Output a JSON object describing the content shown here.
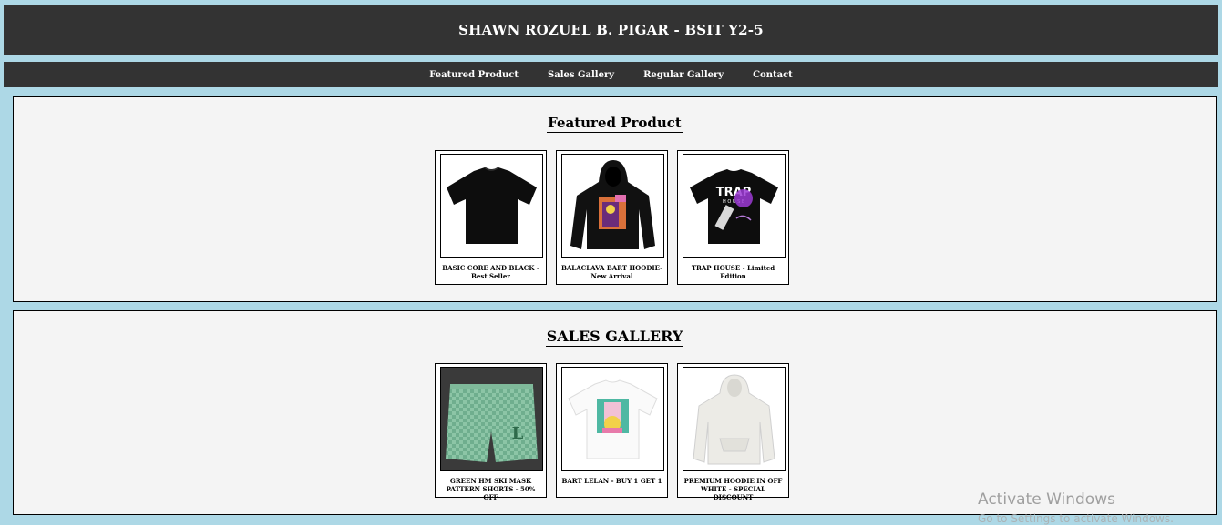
{
  "header": {
    "title": "SHAWN ROZUEL B. PIGAR - BSIT Y2-5"
  },
  "nav": {
    "items": [
      "Featured Product",
      "Sales Gallery",
      "Regular Gallery",
      "Contact"
    ]
  },
  "featured": {
    "title": "Featured Product",
    "products": [
      {
        "caption": "BASIC CORE AND BLACK - Best Seller",
        "image": "black-tshirt"
      },
      {
        "caption": "BALACLAVA BART HOODIE- New Arrival",
        "image": "black-hoodie"
      },
      {
        "caption": "TRAP HOUSE - Limited Edition",
        "image": "trap-house-tshirt"
      }
    ]
  },
  "sales": {
    "title": "SALES GALLERY",
    "products": [
      {
        "caption": "GREEN HM SKI MASK PATTERN SHORTS - 50% OFF",
        "image": "green-shorts"
      },
      {
        "caption": "BART LELAN - BUY 1 GET 1",
        "image": "white-graphic-tshirt"
      },
      {
        "caption": "PREMIUM HOODIE IN OFF WHITE - SPECIAL DISCOUNT",
        "image": "offwhite-hoodie"
      }
    ]
  },
  "watermark": {
    "line1": "Activate Windows",
    "line2": "Go to Settings to activate Windows."
  },
  "colors": {
    "background": "#add8e6",
    "bar": "#333333",
    "panel": "#f4f4f4"
  }
}
